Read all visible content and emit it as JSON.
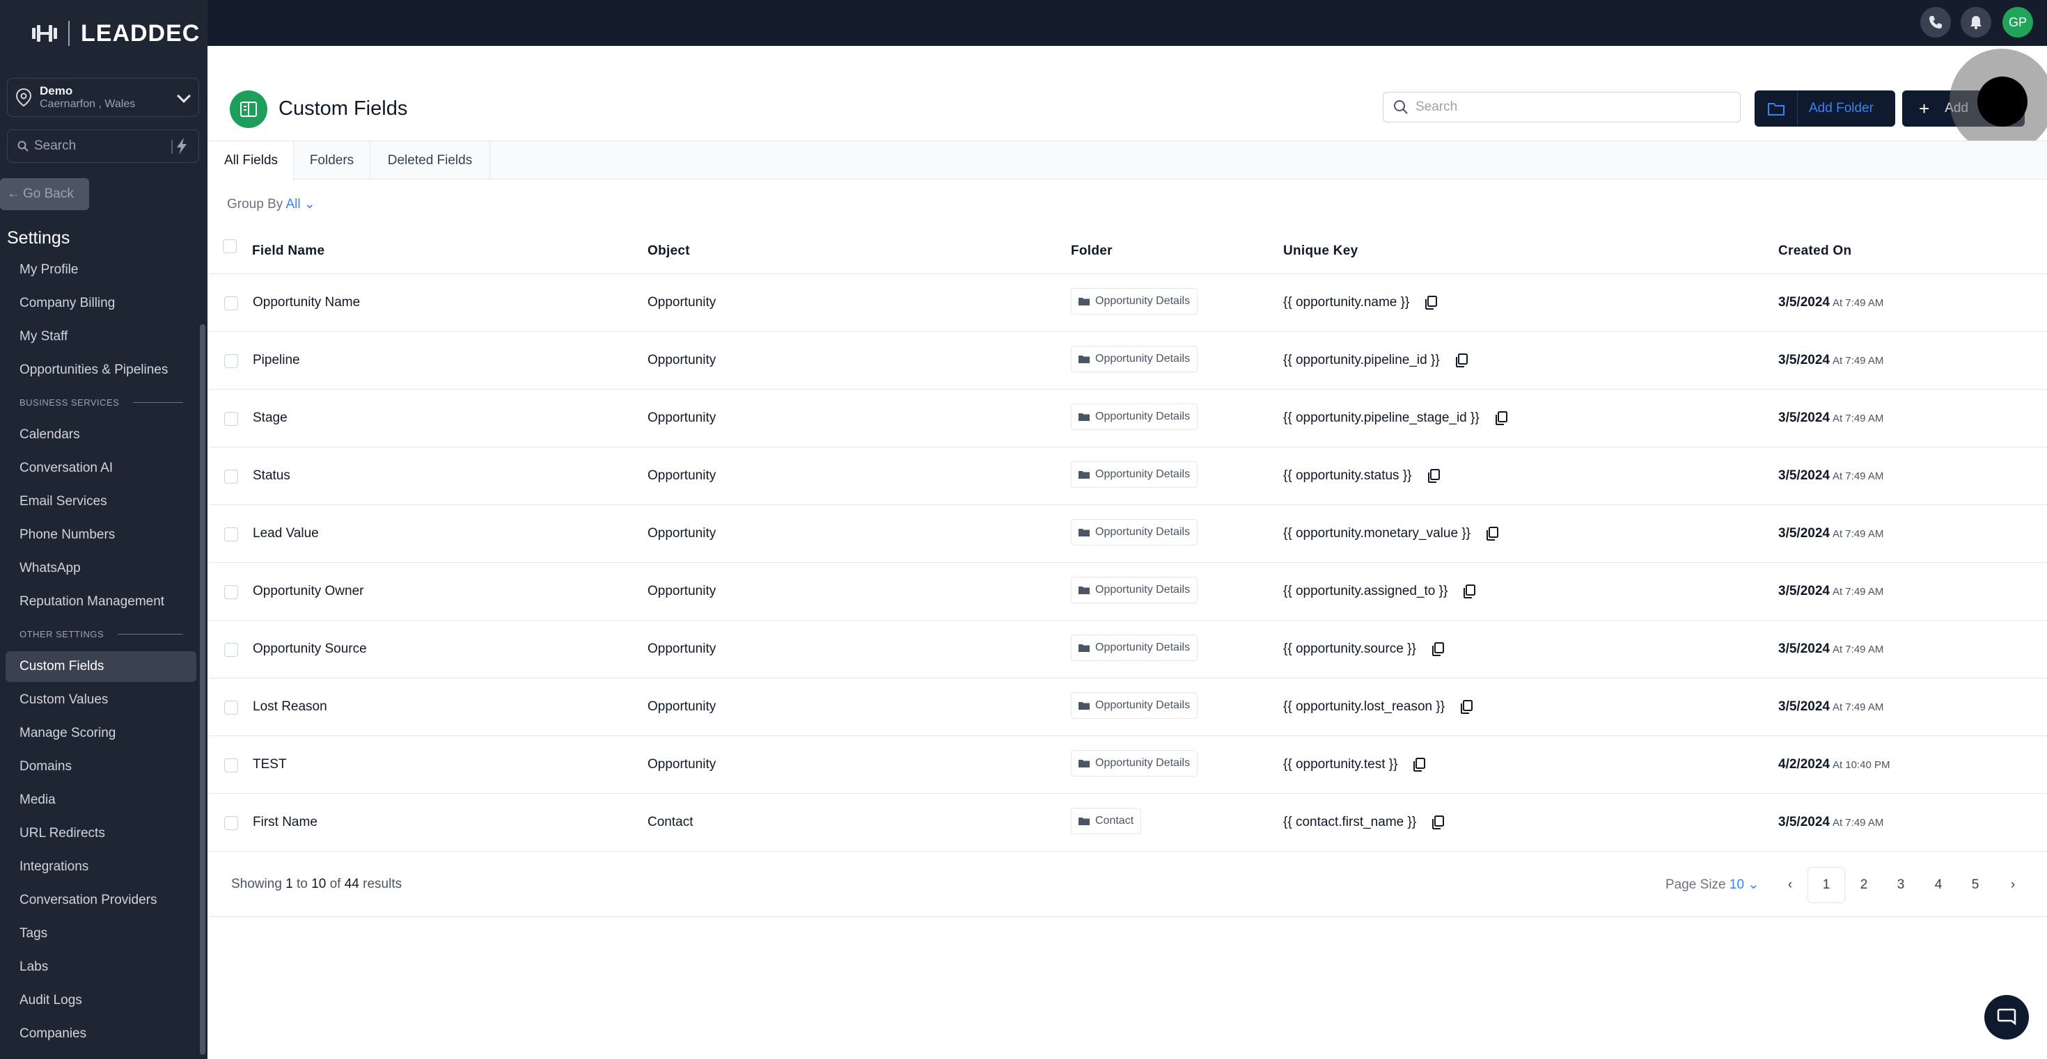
{
  "brand": {
    "name": "LEADDEC"
  },
  "location": {
    "name": "Demo",
    "address": "Caernarfon , Wales"
  },
  "sidebar_search": {
    "placeholder": "Search"
  },
  "go_back": {
    "label": "Go Back"
  },
  "settings_title": "Settings",
  "nav": {
    "top_items": [
      "My Profile",
      "Company Billing",
      "My Staff",
      "Opportunities & Pipelines"
    ],
    "business_section": "BUSINESS SERVICES",
    "business_items": [
      "Calendars",
      "Conversation AI",
      "Email Services",
      "Phone Numbers",
      "WhatsApp",
      "Reputation Management"
    ],
    "other_section": "OTHER SETTINGS",
    "other_items": [
      "Custom Fields",
      "Custom Values",
      "Manage Scoring",
      "Domains",
      "Media",
      "URL Redirects",
      "Integrations",
      "Conversation Providers",
      "Tags",
      "Labs",
      "Audit Logs",
      "Companies"
    ],
    "active_item": "Custom Fields"
  },
  "topbar": {
    "avatar_initials": "GP",
    "icons": [
      "phone-icon",
      "bell-icon"
    ]
  },
  "header": {
    "title": "Custom Fields",
    "search_placeholder": "Search",
    "add_folder_label": "Add Folder",
    "add_field_label": "Add"
  },
  "tabs": [
    "All Fields",
    "Folders",
    "Deleted Fields"
  ],
  "active_tab": "All Fields",
  "group_by": {
    "label": "Group By",
    "value": "All"
  },
  "table": {
    "columns": [
      "Field Name",
      "Object",
      "Folder",
      "Unique Key",
      "Created On"
    ],
    "rows": [
      {
        "name": "Opportunity Name",
        "object": "Opportunity",
        "folder": "Opportunity Details",
        "key": "{{ opportunity.name }}",
        "date": "3/5/2024",
        "time": "At 7:49 AM"
      },
      {
        "name": "Pipeline",
        "object": "Opportunity",
        "folder": "Opportunity Details",
        "key": "{{ opportunity.pipeline_id }}",
        "date": "3/5/2024",
        "time": "At 7:49 AM"
      },
      {
        "name": "Stage",
        "object": "Opportunity",
        "folder": "Opportunity Details",
        "key": "{{ opportunity.pipeline_stage_id }}",
        "date": "3/5/2024",
        "time": "At 7:49 AM"
      },
      {
        "name": "Status",
        "object": "Opportunity",
        "folder": "Opportunity Details",
        "key": "{{ opportunity.status }}",
        "date": "3/5/2024",
        "time": "At 7:49 AM"
      },
      {
        "name": "Lead Value",
        "object": "Opportunity",
        "folder": "Opportunity Details",
        "key": "{{ opportunity.monetary_value }}",
        "date": "3/5/2024",
        "time": "At 7:49 AM"
      },
      {
        "name": "Opportunity Owner",
        "object": "Opportunity",
        "folder": "Opportunity Details",
        "key": "{{ opportunity.assigned_to }}",
        "date": "3/5/2024",
        "time": "At 7:49 AM"
      },
      {
        "name": "Opportunity Source",
        "object": "Opportunity",
        "folder": "Opportunity Details",
        "key": "{{ opportunity.source }}",
        "date": "3/5/2024",
        "time": "At 7:49 AM"
      },
      {
        "name": "Lost Reason",
        "object": "Opportunity",
        "folder": "Opportunity Details",
        "key": "{{ opportunity.lost_reason }}",
        "date": "3/5/2024",
        "time": "At 7:49 AM"
      },
      {
        "name": "TEST",
        "object": "Opportunity",
        "folder": "Opportunity Details",
        "key": "{{ opportunity.test }}",
        "date": "4/2/2024",
        "time": "At 10:40 PM"
      },
      {
        "name": "First Name",
        "object": "Contact",
        "folder": "Contact",
        "key": "{{ contact.first_name }}",
        "date": "3/5/2024",
        "time": "At 7:49 AM"
      }
    ]
  },
  "pagination": {
    "showing_prefix": "Showing",
    "from": "1",
    "to_word": "to",
    "to": "10",
    "of_word": "of",
    "total": "44",
    "results_word": "results",
    "page_size_label": "Page Size",
    "page_size": "10",
    "pages": [
      "1",
      "2",
      "3",
      "4",
      "5"
    ],
    "current_page": "1"
  },
  "colors": {
    "sidebar": "#1e2533",
    "topbar": "#151d2c",
    "accent": "#3b82f6",
    "brand_green": "#1e9e5a"
  }
}
